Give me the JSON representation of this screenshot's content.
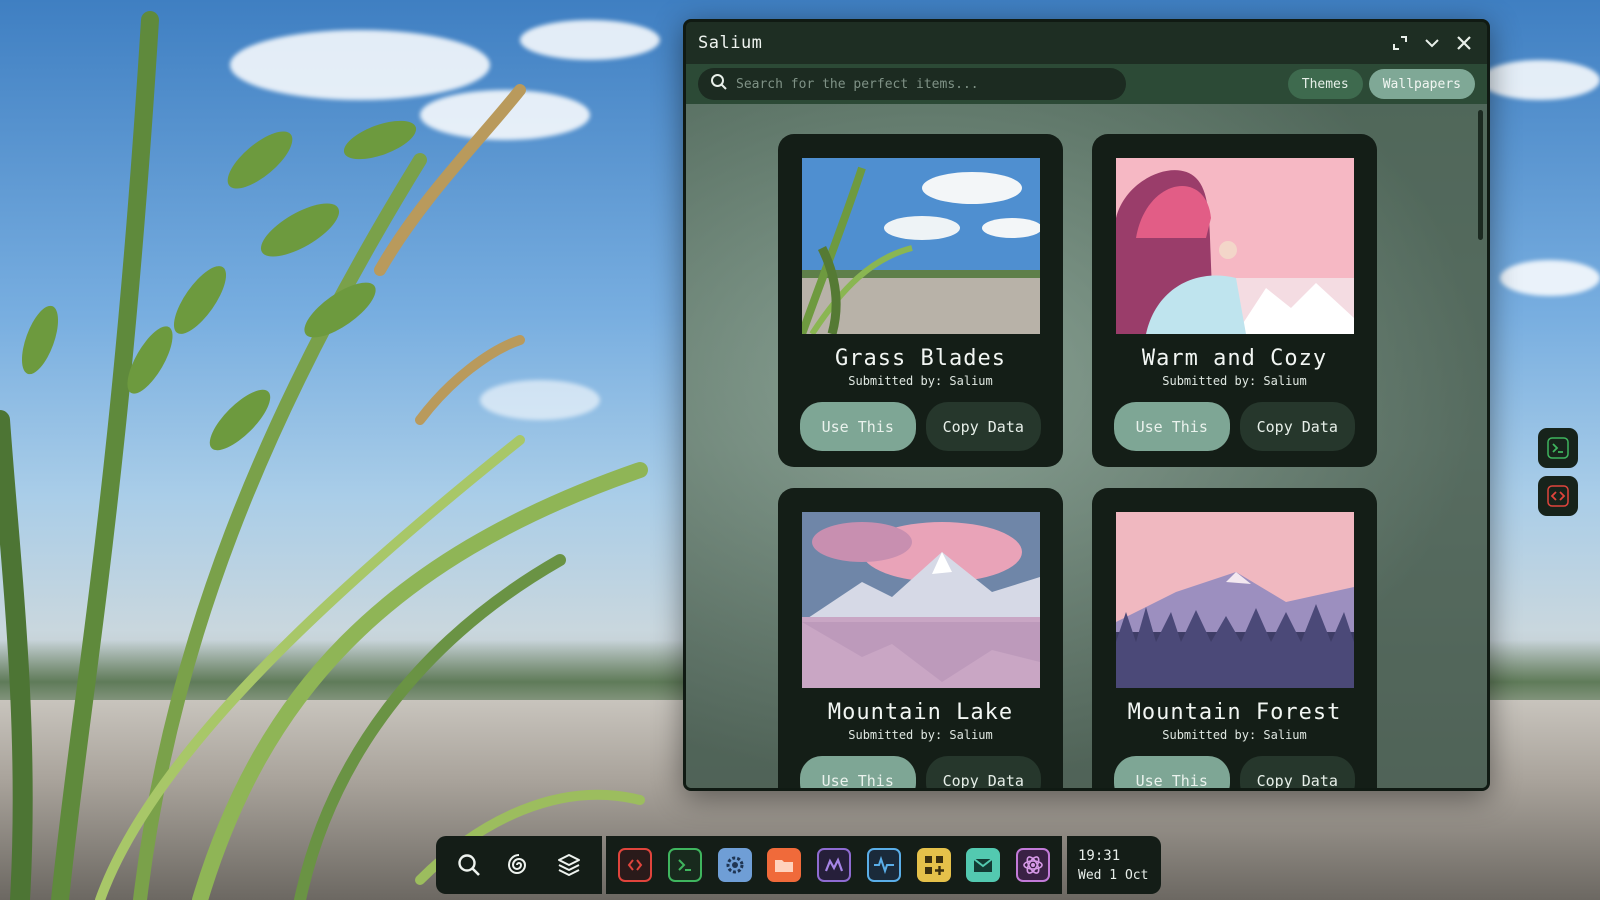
{
  "window": {
    "title": "Salium",
    "controls": [
      "maximize-icon",
      "chevron-down-icon",
      "close-icon"
    ]
  },
  "search": {
    "placeholder": "Search for the perfect items..."
  },
  "tabs": [
    {
      "label": "Themes",
      "active": false
    },
    {
      "label": "Wallpapers",
      "active": true
    }
  ],
  "cards": [
    {
      "title": "Grass Blades",
      "submitted": "Submitted by: Salium",
      "use_label": "Use This",
      "copy_label": "Copy Data"
    },
    {
      "title": "Warm and Cozy",
      "submitted": "Submitted by: Salium",
      "use_label": "Use This",
      "copy_label": "Copy Data"
    },
    {
      "title": "Mountain Lake",
      "submitted": "Submitted by: Salium",
      "use_label": "Use This",
      "copy_label": "Copy Data"
    },
    {
      "title": "Mountain Forest",
      "submitted": "Submitted by: Salium",
      "use_label": "Use This",
      "copy_label": "Copy Data"
    }
  ],
  "side_dock": [
    "terminal-icon",
    "code-icon"
  ],
  "taskbar": {
    "left_icons": [
      "search-icon",
      "spiral-icon",
      "layers-icon"
    ],
    "apps": [
      {
        "name": "code-editor-icon",
        "color": "#e0443c"
      },
      {
        "name": "terminal-icon",
        "color": "#3fb55e"
      },
      {
        "name": "settings-icon",
        "color": "#6f9ed6"
      },
      {
        "name": "files-icon",
        "color": "#f06a3a"
      },
      {
        "name": "monitor-chart-icon",
        "color": "#8e6bd1"
      },
      {
        "name": "activity-icon",
        "color": "#5aaee8"
      },
      {
        "name": "apps-grid-icon",
        "color": "#e5c14a"
      },
      {
        "name": "mail-icon",
        "color": "#53c9b0"
      },
      {
        "name": "atom-icon",
        "color": "#c27ad8"
      }
    ]
  },
  "clock": {
    "time": "19:31",
    "date": "Wed 1 Oct"
  },
  "colors": {
    "window_bg": "#1b2a20",
    "toolbar_bg": "#2c4a36",
    "accent": "#7ea695",
    "card_bg": "#141e17"
  }
}
